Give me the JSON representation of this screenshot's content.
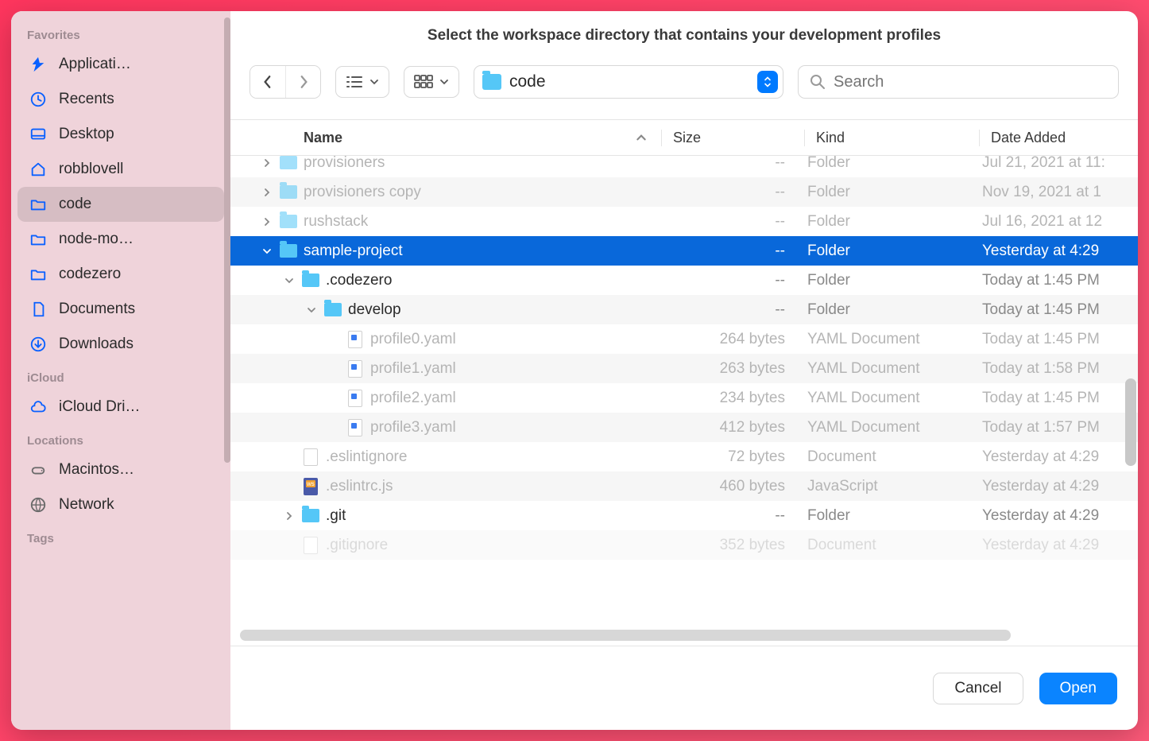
{
  "title": "Select the workspace directory that contains your development profiles",
  "nav": {
    "back_enabled": true,
    "forward_enabled": false
  },
  "path": {
    "label": "code"
  },
  "search": {
    "placeholder": "Search",
    "value": ""
  },
  "columns": {
    "name": "Name",
    "size": "Size",
    "kind": "Kind",
    "date": "Date Added"
  },
  "footer": {
    "cancel": "Cancel",
    "open": "Open"
  },
  "sidebar": {
    "sections": [
      {
        "label": "Favorites",
        "items": [
          {
            "icon": "apps",
            "label": "Applicati…"
          },
          {
            "icon": "recents",
            "label": "Recents"
          },
          {
            "icon": "desktop",
            "label": "Desktop"
          },
          {
            "icon": "home",
            "label": "robblovell"
          },
          {
            "icon": "folder",
            "label": "code",
            "active": true
          },
          {
            "icon": "folder",
            "label": "node-mo…"
          },
          {
            "icon": "folder",
            "label": "codezero"
          },
          {
            "icon": "doc",
            "label": "Documents"
          },
          {
            "icon": "download",
            "label": "Downloads"
          }
        ]
      },
      {
        "label": "iCloud",
        "items": [
          {
            "icon": "cloud",
            "label": "iCloud Dri…"
          }
        ]
      },
      {
        "label": "Locations",
        "items": [
          {
            "icon": "disk",
            "label": "Macintos…"
          },
          {
            "icon": "globe",
            "label": "Network"
          }
        ]
      },
      {
        "label": "Tags",
        "items": []
      }
    ]
  },
  "rows": [
    {
      "depth": 0,
      "disclosure": "right",
      "icon": "folder",
      "name": "provisioners",
      "size": "--",
      "kind": "Folder",
      "date": "Jul 21, 2021 at 11:",
      "dim": true,
      "clipTop": true
    },
    {
      "depth": 0,
      "disclosure": "right",
      "icon": "folder",
      "name": "provisioners copy",
      "size": "--",
      "kind": "Folder",
      "date": "Nov 19, 2021 at 1",
      "dim": true,
      "alt": true
    },
    {
      "depth": 0,
      "disclosure": "right",
      "icon": "folder",
      "name": "rushstack",
      "size": "--",
      "kind": "Folder",
      "date": "Jul 16, 2021 at 12",
      "dim": true
    },
    {
      "depth": 0,
      "disclosure": "down",
      "icon": "folder",
      "name": "sample-project",
      "size": "--",
      "kind": "Folder",
      "date": "Yesterday at 4:29",
      "selected": true
    },
    {
      "depth": 1,
      "disclosure": "down",
      "icon": "folder",
      "name": ".codezero",
      "size": "--",
      "kind": "Folder",
      "date": "Today at 1:45 PM"
    },
    {
      "depth": 2,
      "disclosure": "down",
      "icon": "folder",
      "name": "develop",
      "size": "--",
      "kind": "Folder",
      "date": "Today at 1:45 PM",
      "alt": true
    },
    {
      "depth": 3,
      "disclosure": "",
      "icon": "yaml",
      "name": "profile0.yaml",
      "size": "264 bytes",
      "kind": "YAML Document",
      "date": "Today at 1:45 PM",
      "dim": true
    },
    {
      "depth": 3,
      "disclosure": "",
      "icon": "yaml",
      "name": "profile1.yaml",
      "size": "263 bytes",
      "kind": "YAML Document",
      "date": "Today at 1:58 PM",
      "dim": true,
      "alt": true
    },
    {
      "depth": 3,
      "disclosure": "",
      "icon": "yaml",
      "name": "profile2.yaml",
      "size": "234 bytes",
      "kind": "YAML Document",
      "date": "Today at 1:45 PM",
      "dim": true
    },
    {
      "depth": 3,
      "disclosure": "",
      "icon": "yaml",
      "name": "profile3.yaml",
      "size": "412 bytes",
      "kind": "YAML Document",
      "date": "Today at 1:57 PM",
      "dim": true,
      "alt": true
    },
    {
      "depth": 1,
      "disclosure": "",
      "icon": "file",
      "name": ".eslintignore",
      "size": "72 bytes",
      "kind": "Document",
      "date": "Yesterday at 4:29",
      "dim": true
    },
    {
      "depth": 1,
      "disclosure": "",
      "icon": "js",
      "name": ".eslintrc.js",
      "size": "460 bytes",
      "kind": "JavaScript",
      "date": "Yesterday at 4:29",
      "dim": true,
      "alt": true
    },
    {
      "depth": 1,
      "disclosure": "right",
      "icon": "folder",
      "name": ".git",
      "size": "--",
      "kind": "Folder",
      "date": "Yesterday at 4:29"
    },
    {
      "depth": 1,
      "disclosure": "",
      "icon": "file",
      "name": ".gitignore",
      "size": "352 bytes",
      "kind": "Document",
      "date": "Yesterday at 4:29",
      "dim": true,
      "alt": true,
      "clipBottom": true
    }
  ]
}
